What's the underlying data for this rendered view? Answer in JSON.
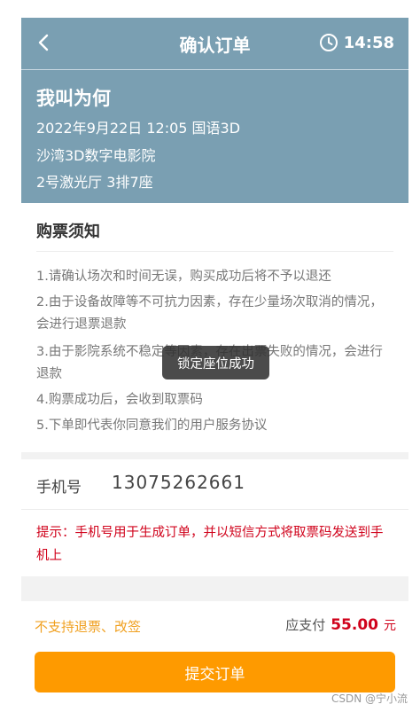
{
  "header": {
    "title": "确认订单",
    "timer": "14:58"
  },
  "movie": {
    "name": "我叫为何",
    "datetime": "2022年9月22日  12:05  国语3D",
    "cinema": "沙湾3D数字电影院",
    "seat": "2号激光厅   3排7座"
  },
  "notice": {
    "title": "购票须知",
    "rules": [
      "1.请确认场次和时间无误，购买成功后将不予以退还",
      "2.由于设备故障等不可抗力因素，存在少量场次取消的情况，会进行退票退款",
      "3.由于影院系统不稳定等因素，存在出票失败的情况，会进行退款",
      "4.购票成功后，会收到取票码",
      "5.下单即代表你同意我们的用户服务协议"
    ]
  },
  "phone": {
    "label": "手机号",
    "value": "13075262661"
  },
  "hint": "提示：手机号用于生成订单，并以短信方式将取票码发送到手机上",
  "summary": {
    "no_refund": "不支持退票、改签",
    "pay_label": "应支付",
    "amount": "55.00",
    "unit": "元"
  },
  "submit_label": "提交订单",
  "toast": "锁定座位成功",
  "watermark": "CSDN @宁小流",
  "colors": {
    "header_bg": "#7a9fb2",
    "accent": "#fe9a00",
    "warning_red": "#d0021b",
    "no_refund_orange": "#f0a020"
  }
}
